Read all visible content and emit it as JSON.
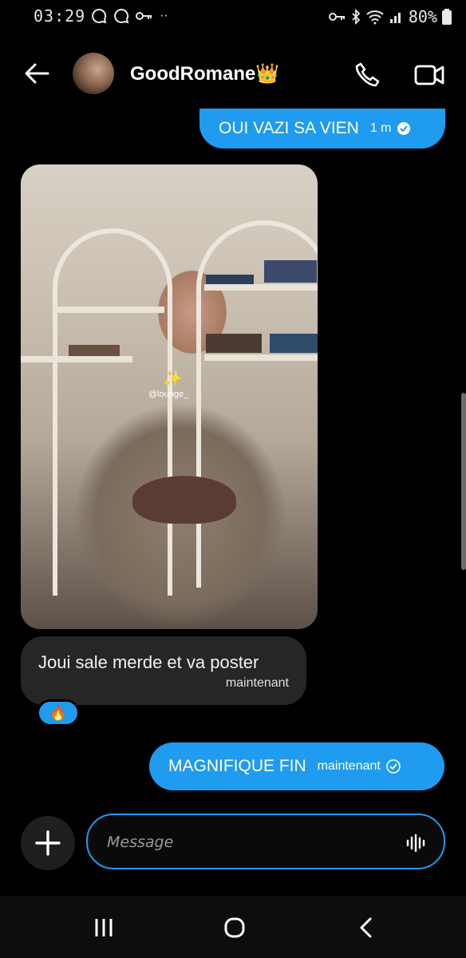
{
  "status_bar": {
    "time": "03:29",
    "battery": "80%"
  },
  "header": {
    "contact_name": "GoodRomane👑"
  },
  "messages": [
    {
      "direction": "outgoing",
      "text": "OUI VAZI SA VIEN",
      "time": "1 m"
    },
    {
      "direction": "incoming",
      "type": "photo",
      "overlay_tag": "@lounge_"
    },
    {
      "direction": "incoming",
      "text": "Joui sale merde et va poster",
      "time": "maintenant",
      "reaction": "🔥"
    },
    {
      "direction": "outgoing",
      "text": "MAGNIFIQUE FIN",
      "time": "maintenant"
    }
  ],
  "composer": {
    "placeholder": "Message"
  },
  "colors": {
    "accent": "#1f9bf0",
    "background": "#000000",
    "incoming_bubble": "#262626"
  },
  "icons": [
    "back-arrow-icon",
    "phone-icon",
    "video-camera-icon",
    "plus-icon",
    "voice-waveform-icon",
    "recent-apps-icon",
    "home-icon",
    "nav-back-icon"
  ]
}
